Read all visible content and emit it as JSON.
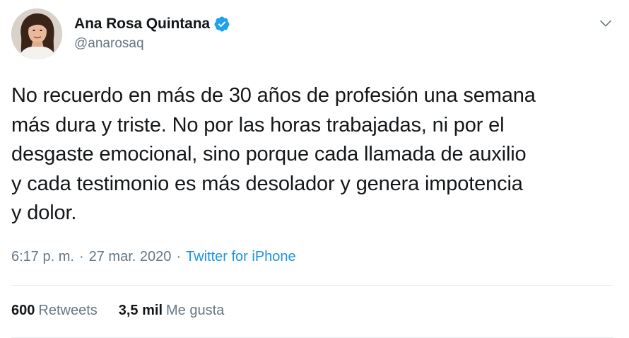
{
  "author": {
    "display_name": "Ana Rosa Quintana",
    "handle": "@anarosaq",
    "verified": true,
    "avatar_icon": "profile-photo"
  },
  "tweet": {
    "text": "No recuerdo en más de 30 años de profesión una semana\nmás dura y triste. No por las horas trabajadas, ni por el\ndesgaste emocional, sino porque cada llamada de auxilio\ny cada testimonio es más desolador y genera impotencia\ny dolor."
  },
  "meta": {
    "time": "6:17 p. m.",
    "separator_1": "·",
    "date": "27 mar. 2020",
    "separator_2": "·",
    "source": "Twitter for iPhone"
  },
  "stats": {
    "retweets_count": "600",
    "retweets_label": "Retweets",
    "likes_count": "3,5 mil",
    "likes_label": "Me gusta"
  },
  "colors": {
    "text_primary": "#14171a",
    "text_secondary": "#657786",
    "link": "#1b95e0",
    "verified": "#1da1f2",
    "divider": "#e6ecf0"
  },
  "icons": {
    "verified": "verified-badge-icon",
    "menu": "chevron-down-icon"
  }
}
